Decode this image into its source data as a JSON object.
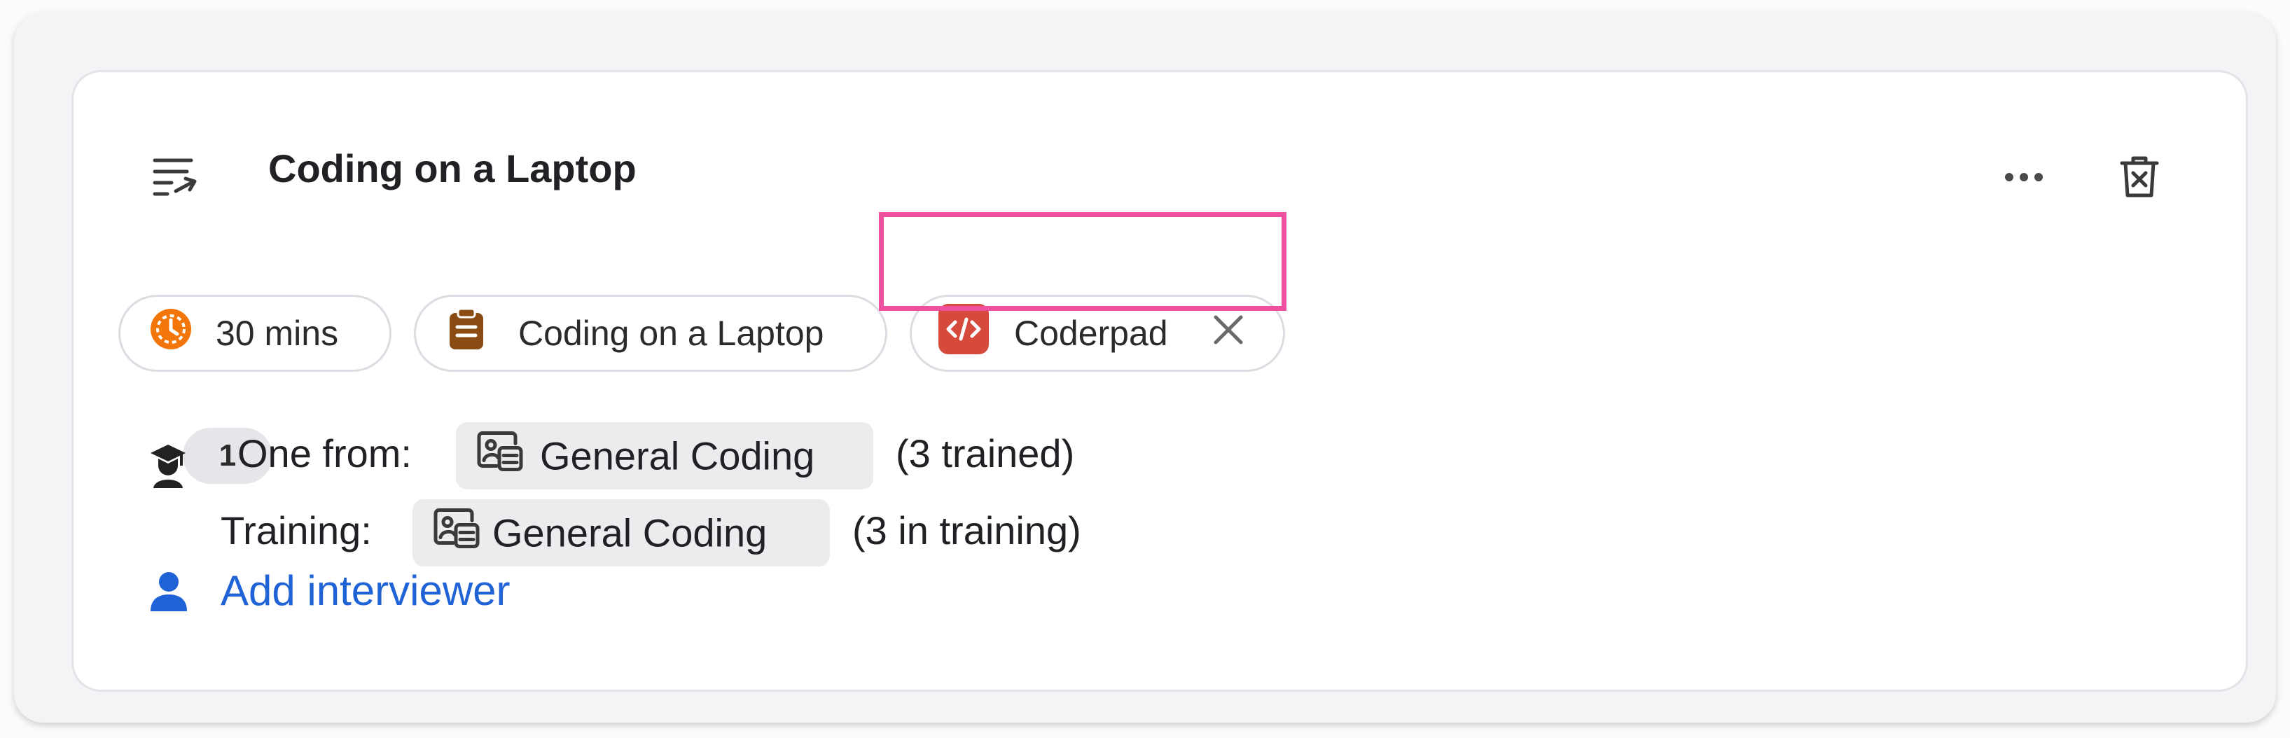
{
  "card": {
    "title": "Coding on a Laptop",
    "icons": {
      "drag": "list-arrow-icon",
      "more": "more-horizontal-icon",
      "delete": "trash-x-icon"
    }
  },
  "tags": [
    {
      "label": "30 mins",
      "icon": "clock-icon",
      "color": "#f2760a"
    },
    {
      "label": "Coding on a Laptop",
      "icon": "clipboard-icon",
      "color": "#8a4c12"
    },
    {
      "label": "Coderpad",
      "icon": "code-icon",
      "color": "#d64a3c",
      "removable": true
    }
  ],
  "interviewers": {
    "primary": {
      "count": "1",
      "prefix": "One from:",
      "pool": "General Coding",
      "suffix": "(3 trained)"
    },
    "training": {
      "prefix": "Training:",
      "pool": "General Coding",
      "suffix": "(3 in training)"
    },
    "add_label": "Add interviewer"
  },
  "colors": {
    "link": "#1f63d6",
    "highlight": "#ee4f9f"
  }
}
